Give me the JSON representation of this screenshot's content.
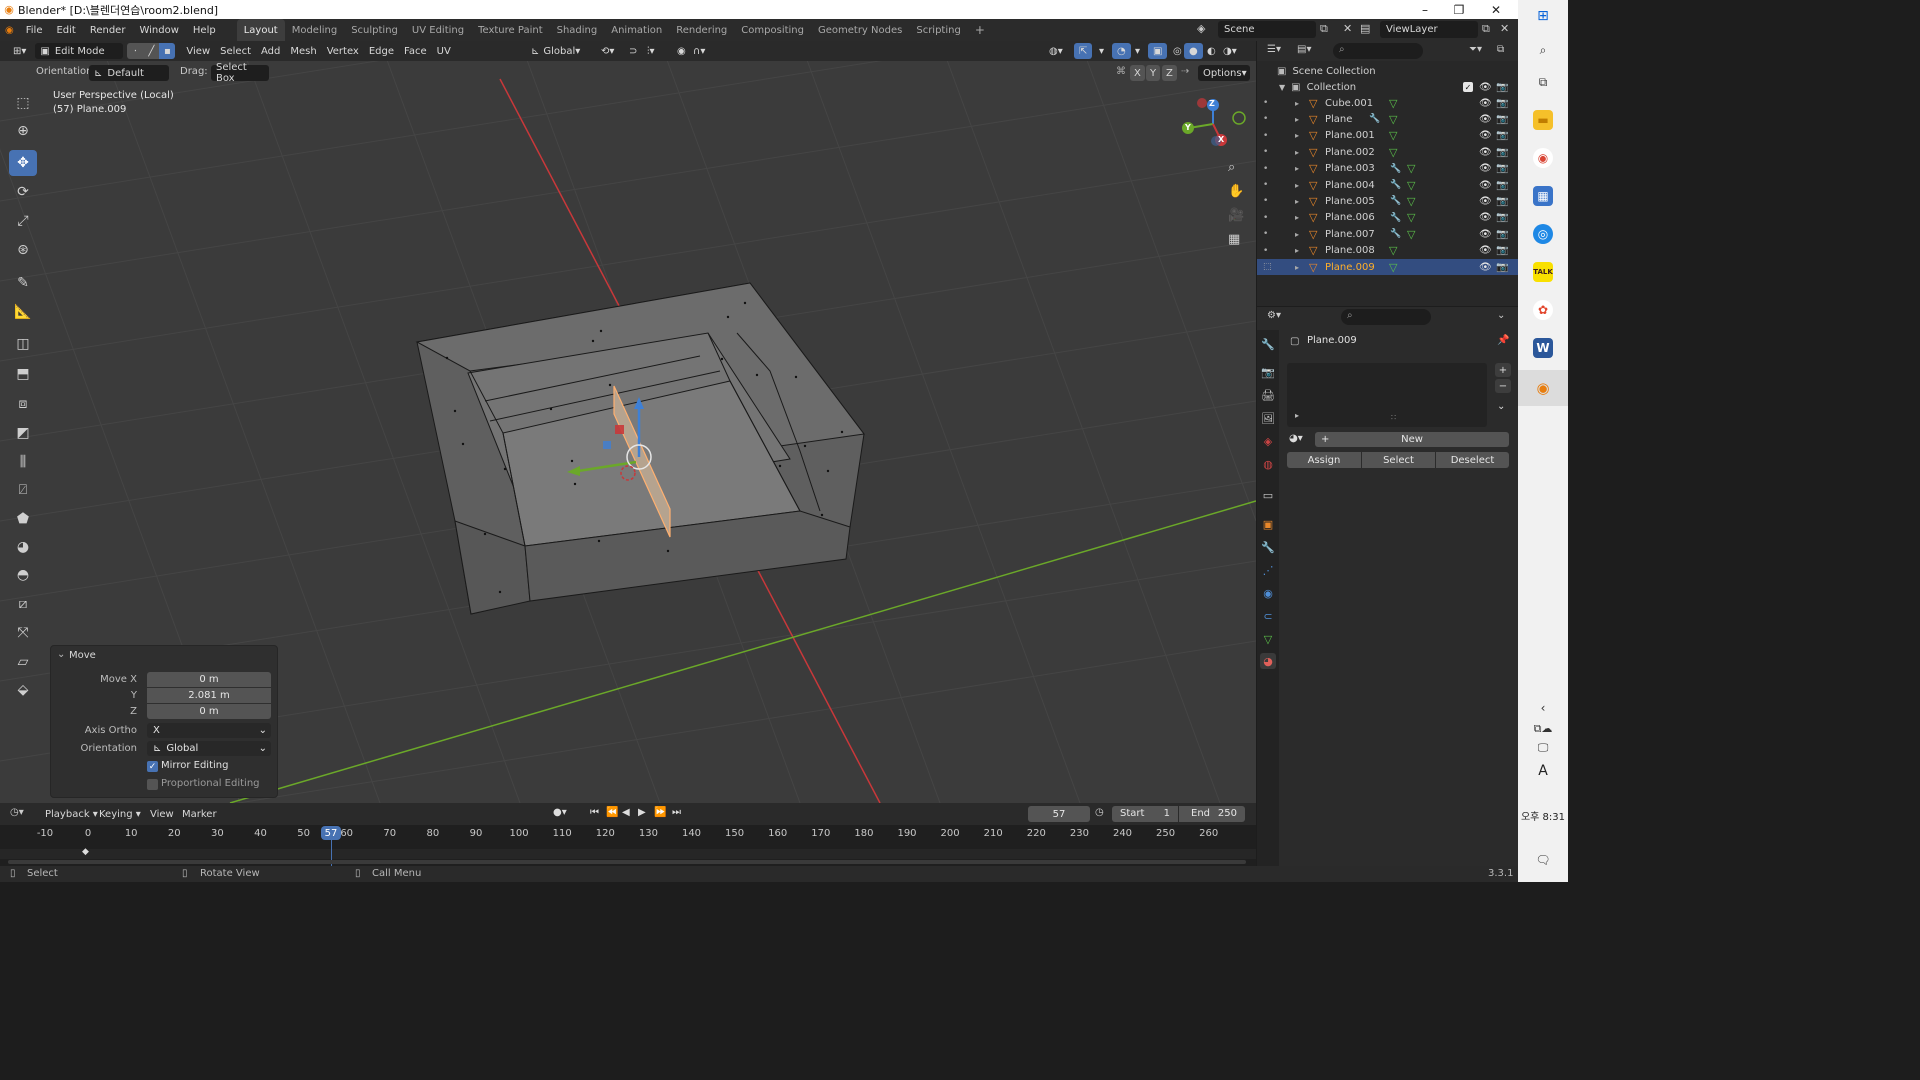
{
  "window": {
    "title": "Blender* [D:\\블렌더연습\\room2.blend]",
    "min": "–",
    "max": "❐",
    "close": "✕"
  },
  "menus": [
    "File",
    "Edit",
    "Render",
    "Window",
    "Help"
  ],
  "workspaces": [
    "Layout",
    "Modeling",
    "Sculpting",
    "UV Editing",
    "Texture Paint",
    "Shading",
    "Animation",
    "Rendering",
    "Compositing",
    "Geometry Nodes",
    "Scripting",
    "+"
  ],
  "active_workspace": "Layout",
  "scene": {
    "label": "Scene",
    "view_layer": "ViewLayer"
  },
  "viewport_header": {
    "mode": "Edit Mode",
    "menus": [
      "View",
      "Select",
      "Add",
      "Mesh",
      "Vertex",
      "Edge",
      "Face",
      "UV"
    ],
    "transform": "Global",
    "orientation_label": "Orientation:",
    "orientation_value": "Default",
    "drag_label": "Drag:",
    "drag_value": "Select Box",
    "axis_x": "X",
    "axis_y": "Y",
    "axis_z": "Z",
    "options": "Options"
  },
  "viewport": {
    "perspective": "User Perspective (Local)",
    "object": "(57) Plane.009"
  },
  "gizmo": {
    "x": "X",
    "y": "Y",
    "z": "Z"
  },
  "operator_panel": {
    "title": "Move",
    "move_x_label": "Move X",
    "move_x": "0 m",
    "y_label": "Y",
    "y": "2.081 m",
    "z_label": "Z",
    "z": "0 m",
    "axis_ortho_label": "Axis Ortho",
    "axis_ortho": "X",
    "orientation_label": "Orientation",
    "orientation": "Global",
    "mirror_editing": "Mirror Editing",
    "proportional_editing": "Proportional Editing"
  },
  "outliner": {
    "scene_collection": "Scene Collection",
    "collection": "Collection",
    "items": [
      {
        "name": "Cube.001",
        "modifier": false
      },
      {
        "name": "Plane",
        "modifier": true
      },
      {
        "name": "Plane.001",
        "modifier": false
      },
      {
        "name": "Plane.002",
        "modifier": false
      },
      {
        "name": "Plane.003",
        "modifier": true
      },
      {
        "name": "Plane.004",
        "modifier": true
      },
      {
        "name": "Plane.005",
        "modifier": true
      },
      {
        "name": "Plane.006",
        "modifier": true
      },
      {
        "name": "Plane.007",
        "modifier": true
      },
      {
        "name": "Plane.008",
        "modifier": false
      },
      {
        "name": "Plane.009",
        "modifier": false
      }
    ],
    "selected": "Plane.009"
  },
  "properties": {
    "object": "Plane.009",
    "new": "New",
    "assign": "Assign",
    "select": "Select",
    "deselect": "Deselect"
  },
  "timeline": {
    "menus": [
      "Playback",
      "Keying",
      "View",
      "Marker"
    ],
    "current_frame": "57",
    "start_label": "Start",
    "start": "1",
    "end_label": "End",
    "end": "250",
    "ticks": [
      "-10",
      "0",
      "10",
      "20",
      "30",
      "40",
      "50",
      "60",
      "70",
      "80",
      "90",
      "100",
      "110",
      "120",
      "130",
      "140",
      "150",
      "160",
      "170",
      "180",
      "190",
      "200",
      "210",
      "220",
      "230",
      "240",
      "250",
      "260"
    ]
  },
  "statusbar": {
    "select": "Select",
    "rotate": "Rotate View",
    "menu": "Call Menu",
    "version": "3.3.1"
  },
  "system_tray": {
    "time": "오후 8:31",
    "ime": "A"
  },
  "colors": {
    "accent": "#4772b3",
    "selected_row": "#334d80",
    "active_object": "#ffaf29",
    "x_axis": "#c8383a",
    "y_axis": "#6ba829",
    "z_axis": "#3e80d6"
  }
}
